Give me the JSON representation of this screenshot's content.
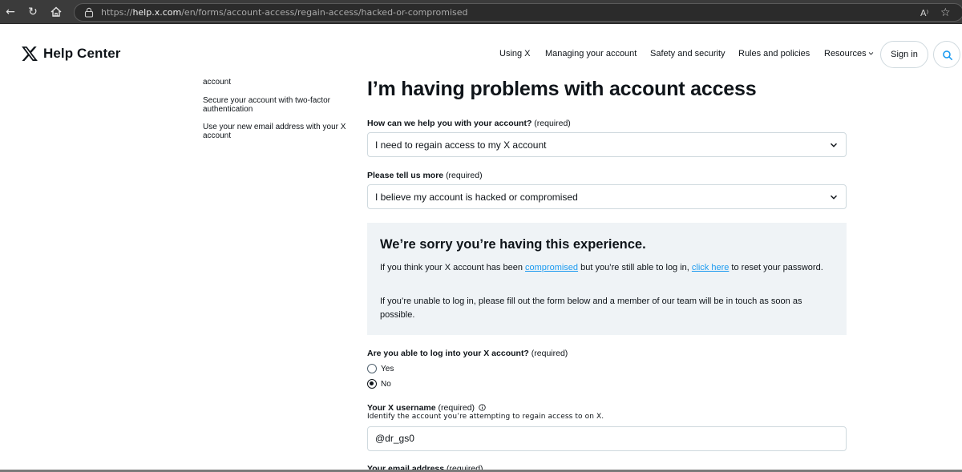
{
  "browser": {
    "url_prefix": "https://",
    "url_host": "help.x.com",
    "url_path": "/en/forms/account-access/regain-access/hacked-or-compromised",
    "read_aloud": "A⁾"
  },
  "header": {
    "logo_text": "Help Center",
    "nav": [
      "Using X",
      "Managing your account",
      "Safety and security",
      "Rules and policies",
      "Resources"
    ],
    "sign_in": "Sign in"
  },
  "sidebar": {
    "items": [
      "account",
      "Secure your account with two-factor authentication",
      "Use your new email address with your X account"
    ]
  },
  "main": {
    "title": "I’m having problems with account access",
    "q1_label": "How can we help you with your account?",
    "q1_value": "I need to regain access to my X account",
    "q2_label": "Please tell us more",
    "q2_value": "I believe my account is hacked or compromised",
    "required": "(required)",
    "notice": {
      "title": "We’re sorry you’re having this experience.",
      "p1_a": "If you think your X account has been ",
      "p1_link1": "compromised",
      "p1_b": " but you’re still able to log in, ",
      "p1_link2": "click here",
      "p1_c": " to reset your password.",
      "p2": "If you’re unable to log in, please fill out the form below and a member of our team will be in touch as soon as possible."
    },
    "login_label": "Are you able to log into your X account?",
    "options": [
      {
        "label": "Yes",
        "checked": false
      },
      {
        "label": "No",
        "checked": true
      }
    ],
    "username_label": "Your X username",
    "username_help": "Identify the account you’re attempting to regain access to on X.",
    "username_value": "@dr_gs0",
    "email_label": "Your email address"
  },
  "colors": {
    "link": "#1d9bf0",
    "notice_bg": "#eff3f6",
    "border": "#cfd9de"
  }
}
